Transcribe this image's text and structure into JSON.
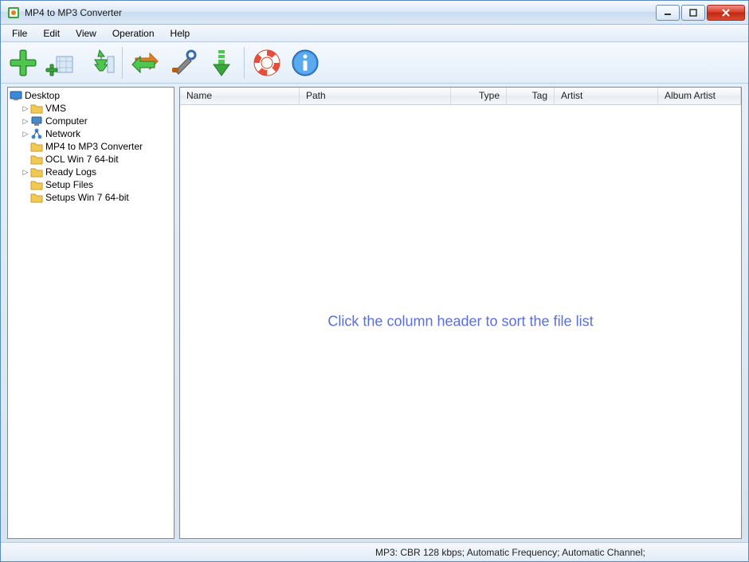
{
  "window": {
    "title": "MP4 to MP3 Converter"
  },
  "menu": {
    "file": "File",
    "edit": "Edit",
    "view": "View",
    "operation": "Operation",
    "help": "Help"
  },
  "toolbar": {
    "add_file": "add-file",
    "add_folder": "add-folder",
    "add_subtree": "add-subtree",
    "convert": "convert",
    "settings": "settings",
    "download": "download",
    "help": "help",
    "about": "about"
  },
  "tree": {
    "root": "Desktop",
    "items": [
      {
        "label": "VMS",
        "icon": "folder",
        "toggle": "▷"
      },
      {
        "label": "Computer",
        "icon": "computer",
        "toggle": "▷"
      },
      {
        "label": "Network",
        "icon": "network",
        "toggle": "▷"
      },
      {
        "label": "MP4 to MP3 Converter",
        "icon": "folder",
        "toggle": ""
      },
      {
        "label": "OCL Win 7 64-bit",
        "icon": "folder",
        "toggle": ""
      },
      {
        "label": "Ready Logs",
        "icon": "folder",
        "toggle": "▷"
      },
      {
        "label": "Setup Files",
        "icon": "folder",
        "toggle": ""
      },
      {
        "label": "Setups Win 7 64-bit",
        "icon": "folder",
        "toggle": ""
      }
    ]
  },
  "columns": {
    "name": "Name",
    "path": "Path",
    "type": "Type",
    "tag": "Tag",
    "artist": "Artist",
    "album_artist": "Album Artist"
  },
  "hint": "Click the column header to sort the file list",
  "status": "MP3:  CBR 128 kbps; Automatic Frequency; Automatic Channel;"
}
